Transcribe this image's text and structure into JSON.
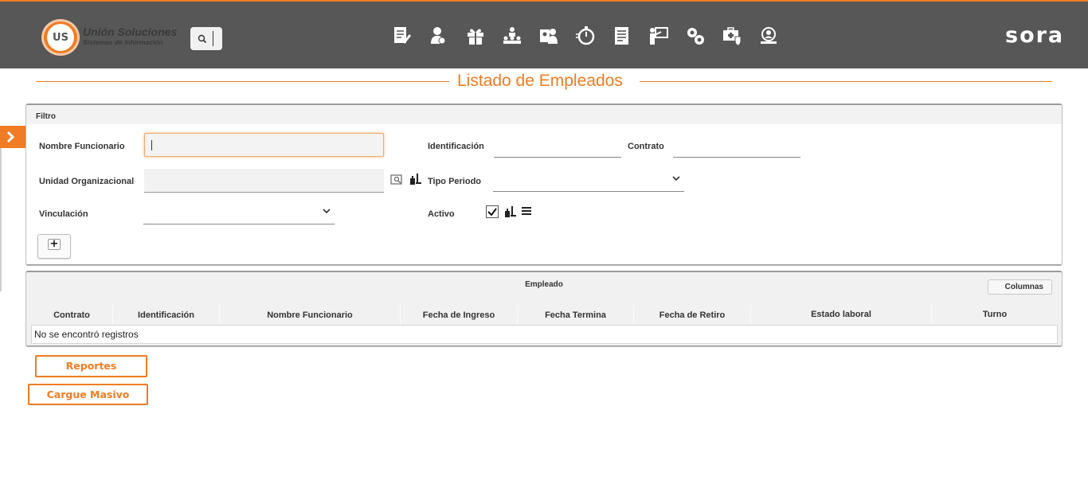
{
  "header": {
    "brand_name": "Unión Soluciones",
    "brand_tagline": "Sistemas de Información",
    "logo_text": "US",
    "product_name": "sora",
    "nav_icons": [
      "document-edit-icon",
      "user-person-icon",
      "gift-icon",
      "org-hierarchy-icon",
      "user-card-icon",
      "stopwatch-icon",
      "report-list-icon",
      "presentation-board-icon",
      "gears-icon",
      "medical-kit-shield-icon",
      "user-search-icon"
    ]
  },
  "page": {
    "title": "Listado de Empleados"
  },
  "filter": {
    "heading": "Filtro",
    "nombre_label": "Nombre Funcionario",
    "nombre_value": "",
    "identificacion_label": "Identificación",
    "identificacion_value": "",
    "contrato_label": "Contrato",
    "contrato_value": "",
    "unidad_label": "Unidad Organizacional",
    "unidad_value": "",
    "tipo_periodo_label": "Tipo Periodo",
    "tipo_periodo_value": "",
    "vinculacion_label": "Vinculación",
    "vinculacion_value": "",
    "activo_label": "Activo",
    "activo_checked": true,
    "add_label": "+"
  },
  "table": {
    "title": "Empleado",
    "columns_button": "Columnas",
    "columns": [
      "Contrato",
      "Identificación",
      "Nombre Funcionario",
      "Fecha de Ingreso",
      "Fecha Termina",
      "Fecha de Retiro",
      "Estado laboral",
      "Turno"
    ],
    "empty_message": "No se encontró registros"
  },
  "actions": {
    "reportes": "Reportes",
    "cargue_masivo": "Cargue Masivo"
  },
  "colors": {
    "accent": "#f07c23",
    "header_bg": "#575757"
  }
}
